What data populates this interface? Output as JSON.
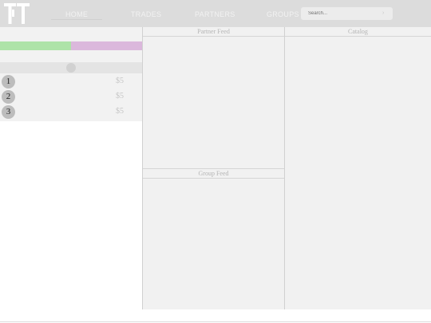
{
  "nav": {
    "logo_text": "TT",
    "links": [
      {
        "label": "HOME",
        "active": true
      },
      {
        "label": "TRADES",
        "active": false
      },
      {
        "label": "PARTNERS",
        "active": false
      },
      {
        "label": "GROUPS",
        "active": false
      }
    ],
    "search_placeholder": "Search..."
  },
  "progress": {
    "green_fraction": 0.5
  },
  "list": [
    {
      "rank": "1",
      "price": "$5"
    },
    {
      "rank": "2",
      "price": "$5"
    },
    {
      "rank": "3",
      "price": "$5"
    }
  ],
  "panels": {
    "partner_feed": "Partner Feed",
    "group_feed": "Group Feed",
    "catalog": "Catalog"
  },
  "colors": {
    "navbar": "#dcdcdc",
    "progress_green": "#aee3a8",
    "progress_purple": "#dbb8dc",
    "panel_bg": "#f1f1f1"
  }
}
